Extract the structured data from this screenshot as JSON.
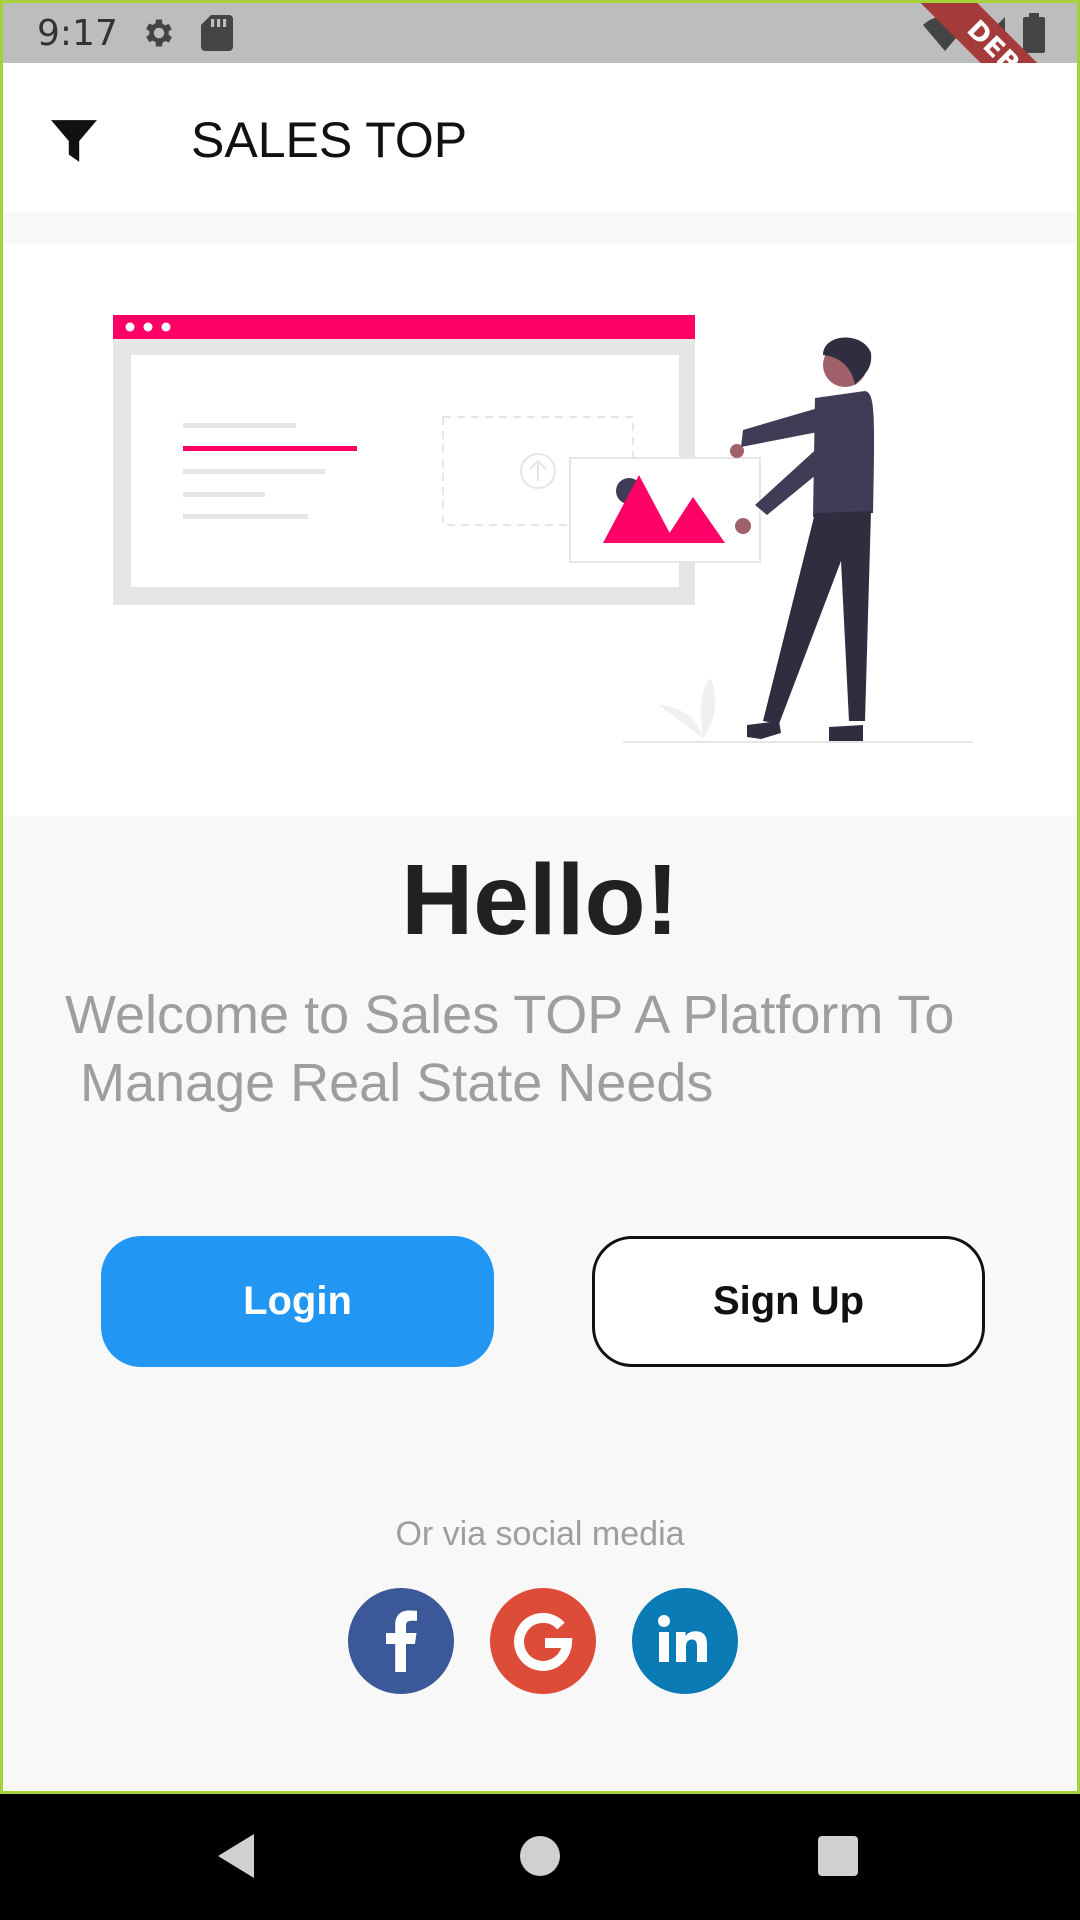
{
  "status_bar": {
    "time": "9:17",
    "icons": [
      "settings-icon",
      "sd-card-icon",
      "wifi-icon",
      "signal-icon",
      "battery-icon"
    ],
    "debug_label": "DEBUG"
  },
  "app_bar": {
    "title": "SALES TOP",
    "filter_icon": "filter-icon"
  },
  "main": {
    "heading": "Hello!",
    "welcome_line1": "Welcome to Sales TOP A Platform To",
    "welcome_line2": " Manage Real State Needs",
    "login_label": "Login",
    "signup_label": "Sign Up",
    "social_label": "Or via social media",
    "social": [
      {
        "name": "facebook",
        "icon": "facebook-icon"
      },
      {
        "name": "google",
        "icon": "google-icon"
      },
      {
        "name": "linkedin",
        "icon": "linkedin-icon"
      }
    ]
  },
  "colors": {
    "accent": "#2196f3",
    "brand_pink": "#ff0066",
    "facebook": "#3b5998",
    "google": "#dd4b39",
    "linkedin": "#0a7bb5"
  },
  "nav": {
    "back": "back-icon",
    "home": "home-icon",
    "recents": "recents-icon"
  }
}
